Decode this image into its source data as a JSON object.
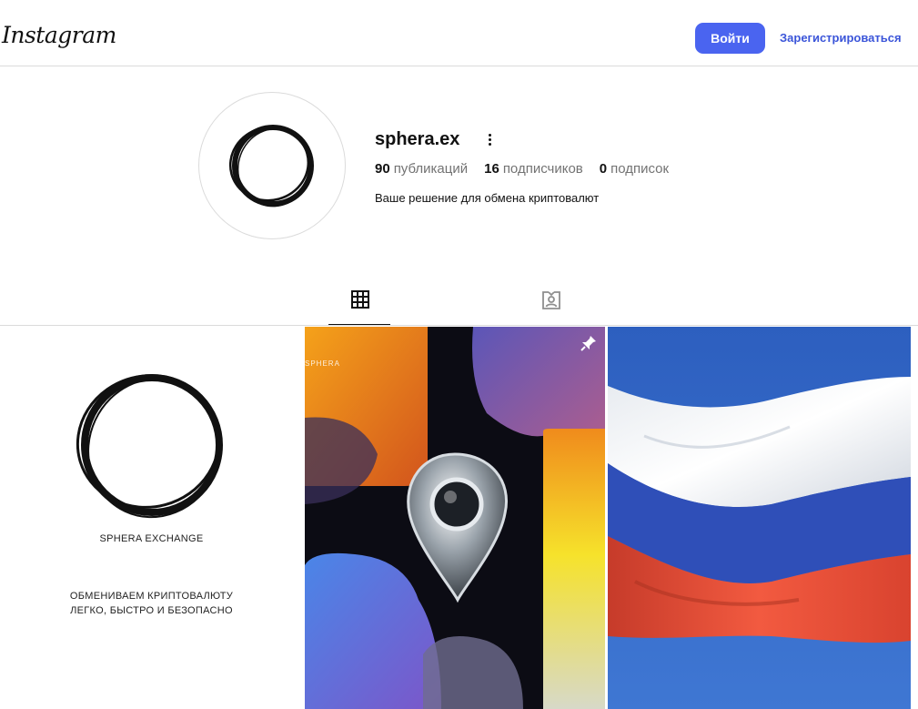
{
  "header": {
    "logo_text": "Instagram",
    "login_label": "Войти",
    "signup_label": "Зарегистрироваться",
    "accent_color": "#4a64f0"
  },
  "profile": {
    "username": "sphera.ex",
    "stats": [
      {
        "value": "90",
        "label": "публикаций"
      },
      {
        "value": "16",
        "label": "подписчиков"
      },
      {
        "value": "0",
        "label": "подписок"
      }
    ],
    "bio": "Ваше решение для обмена криптовалют"
  },
  "tabs": [
    {
      "icon": "grid-icon",
      "active": true
    },
    {
      "icon": "tagged-icon",
      "active": false
    }
  ],
  "posts": [
    {
      "kind": "logo-card",
      "brand": "SPHERA EXCHANGE",
      "tagline_1": "ОБМЕНИВАЕМ КРИПТОВАЛЮТУ",
      "tagline_2": "ЛЕГКО, БЫСТРО И БЕЗОПАСНО"
    },
    {
      "kind": "crypto-graphic",
      "pinned": true,
      "corner_text": "SPHERA"
    },
    {
      "kind": "photo",
      "subject": "russian-flag"
    }
  ]
}
